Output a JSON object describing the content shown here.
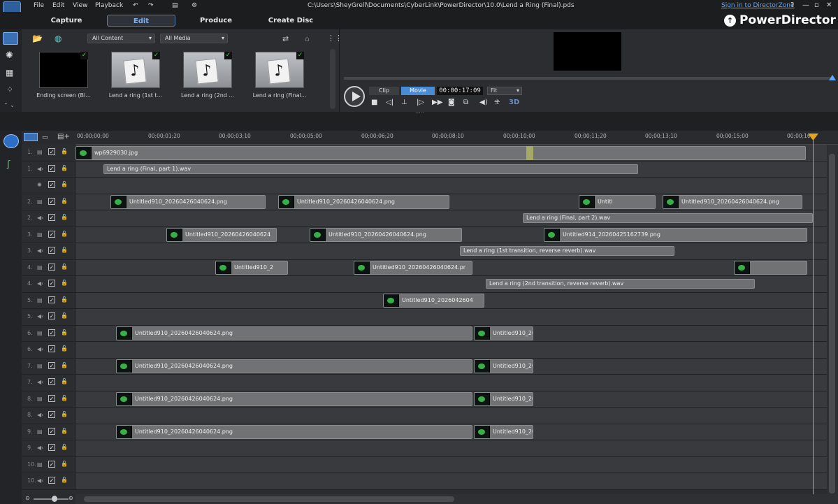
{
  "menu": {
    "file": "File",
    "edit": "Edit",
    "view": "View",
    "playback": "Playback"
  },
  "title": "C:\\Users\\SheyGrell\\Documents\\CyberLink\\PowerDirector\\10.0\\Lend a Ring (Final).pds",
  "signin": "Sign in to DirectorZone",
  "window": {
    "help": "?",
    "minimize": "—",
    "restore": "▫",
    "close": "✕"
  },
  "tabs": {
    "capture": "Capture",
    "edit": "Edit",
    "produce": "Produce",
    "create_disc": "Create Disc"
  },
  "brand": "PowerDirector",
  "library": {
    "filter_content": "All Content",
    "filter_media": "All Media",
    "items": [
      {
        "label": "Ending screen (Bl...",
        "kind": "video"
      },
      {
        "label": "Lend a ring (1st t...",
        "kind": "music"
      },
      {
        "label": "Lend a ring (2nd ...",
        "kind": "music"
      },
      {
        "label": "Lend a ring (Final...",
        "kind": "music"
      }
    ]
  },
  "preview": {
    "clip_label": "Clip",
    "movie_label": "Movie",
    "timecode": "00:00:17:09",
    "fit": "Fit",
    "threed": "3D"
  },
  "ruler": [
    "00;00;00;00",
    "00;00;01;20",
    "00;00;03;10",
    "00;00;05;00",
    "00;00;06;20",
    "00;00;08;10",
    "00;00;10;00",
    "00;00;11;20",
    "00;00;13;10",
    "00;00;15;00",
    "00;00;16;"
  ],
  "tracks": [
    {
      "num": "1.",
      "type": "video"
    },
    {
      "num": "1.",
      "type": "audio"
    },
    {
      "num": "",
      "type": "fx"
    },
    {
      "num": "2.",
      "type": "video"
    },
    {
      "num": "2.",
      "type": "audio"
    },
    {
      "num": "3.",
      "type": "video"
    },
    {
      "num": "3.",
      "type": "audio"
    },
    {
      "num": "4.",
      "type": "video"
    },
    {
      "num": "4.",
      "type": "audio"
    },
    {
      "num": "5.",
      "type": "video"
    },
    {
      "num": "5.",
      "type": "audio"
    },
    {
      "num": "6.",
      "type": "video"
    },
    {
      "num": "6.",
      "type": "audio"
    },
    {
      "num": "7.",
      "type": "video"
    },
    {
      "num": "7.",
      "type": "audio"
    },
    {
      "num": "8.",
      "type": "video"
    },
    {
      "num": "8.",
      "type": "audio"
    },
    {
      "num": "9.",
      "type": "video"
    },
    {
      "num": "9.",
      "type": "audio"
    },
    {
      "num": "10.",
      "type": "video"
    },
    {
      "num": "10.",
      "type": "audio"
    }
  ],
  "clips": {
    "wp": "wp6929030.jpg",
    "audio1": "Lend a ring (Final, part 1).wav",
    "u910": "Untitled910_20260426040624.png",
    "u910_short1": "Untitled910_20260426040624",
    "u910_short2": "Untitled910_2",
    "u910_short3": "Untitled910_20260426040624.pr",
    "u910_short4": "Untitled910_2026042604",
    "u910_tiny": "Untitled910_20",
    "untitl": "Untitl",
    "audio2": "Lend a ring (Final, part 2).wav",
    "u914": "Untitled914_20260425162739.png",
    "audio3": "Lend a ring (1st transition, reverse reverb).wav",
    "audio4": "Lend a ring (2nd transition, reverse reverb).wav"
  },
  "colors": {
    "accent": "#7fb0ef",
    "playhead": "#35c7ff",
    "clip": "#707274"
  }
}
